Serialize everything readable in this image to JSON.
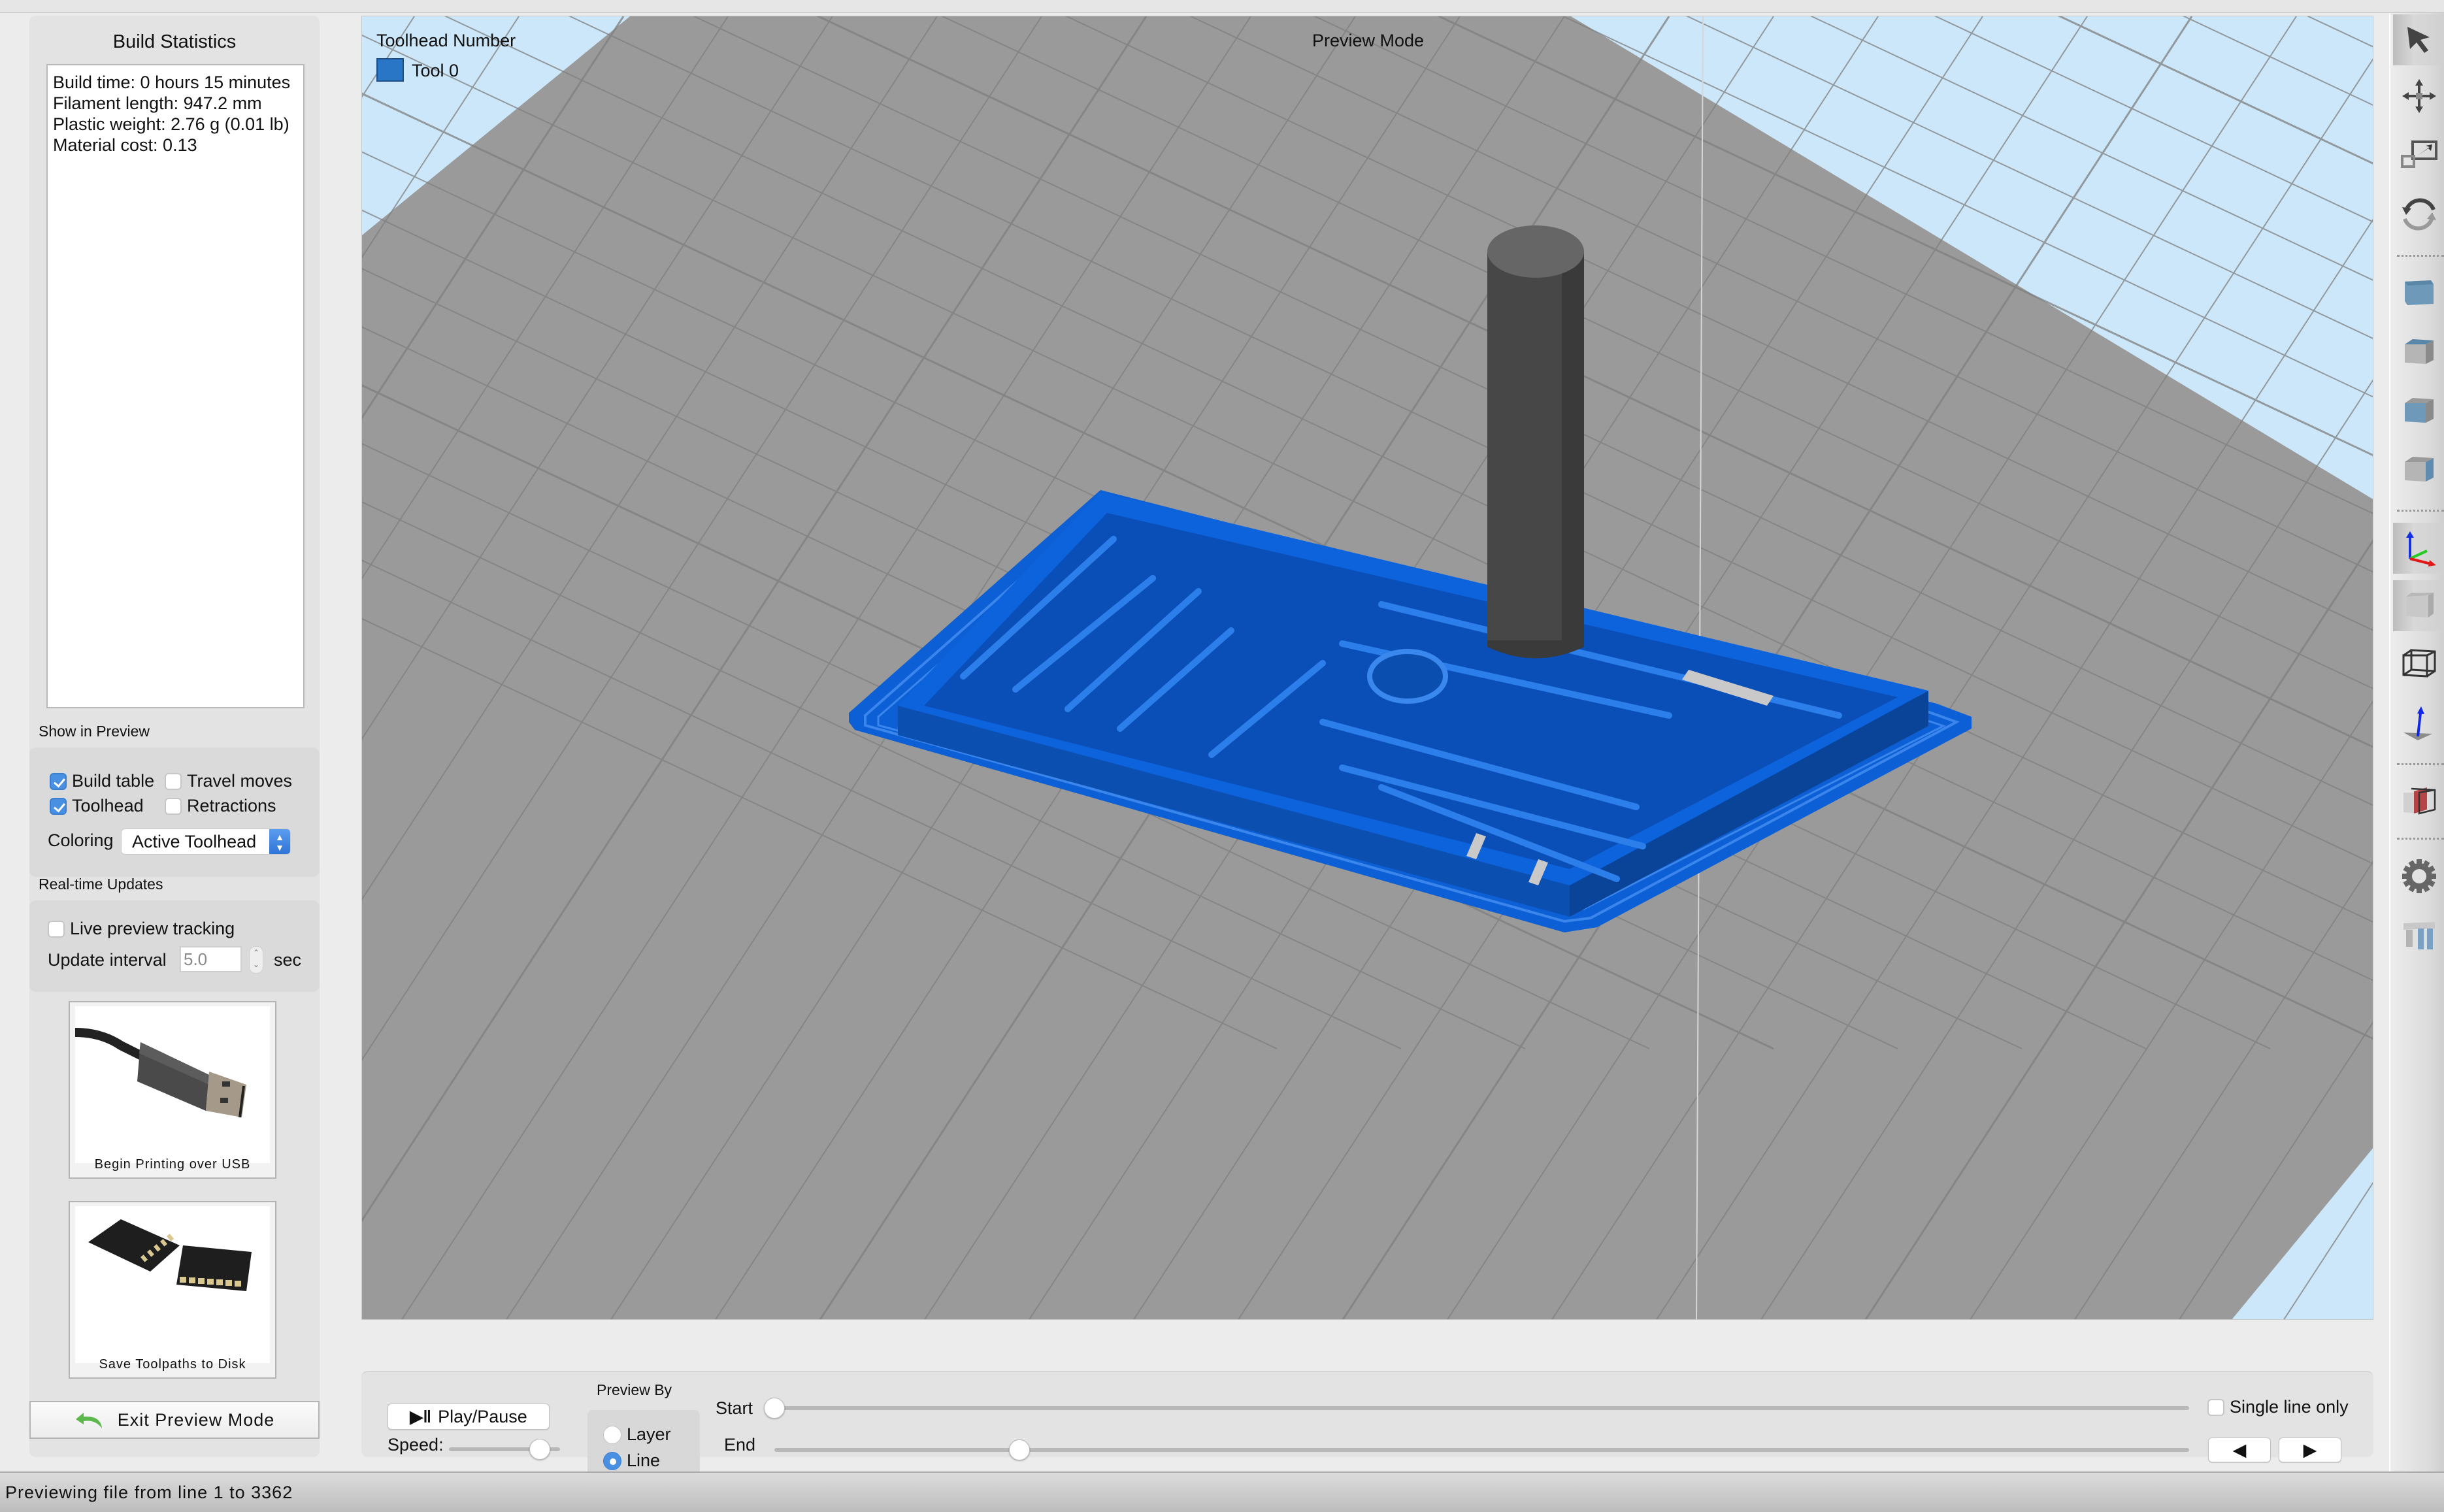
{
  "build_statistics": {
    "title": "Build Statistics",
    "lines": [
      "Build time: 0 hours 15 minutes",
      "Filament length: 947.2 mm",
      "Plastic weight: 2.76 g (0.01 lb)",
      "Material cost: 0.13"
    ]
  },
  "show_in_preview": {
    "label": "Show in Preview",
    "build_table": {
      "label": "Build table",
      "checked": true
    },
    "travel_moves": {
      "label": "Travel moves",
      "checked": false
    },
    "toolhead": {
      "label": "Toolhead",
      "checked": true
    },
    "retractions": {
      "label": "Retractions",
      "checked": false
    },
    "coloring_label": "Coloring",
    "coloring_value": "Active Toolhead"
  },
  "realtime_updates": {
    "label": "Real-time Updates",
    "live_tracking": {
      "label": "Live preview tracking",
      "checked": false
    },
    "interval_label": "Update interval",
    "interval_value": "5.0",
    "interval_unit": "sec"
  },
  "actions": {
    "usb_caption": "Begin Printing over USB",
    "disk_caption": "Save Toolpaths to Disk",
    "exit_label": "Exit Preview Mode"
  },
  "viewport": {
    "legend_title": "Toolhead Number",
    "legend_items": [
      {
        "label": "Tool 0",
        "color": "#2a76c6"
      }
    ],
    "mode_label": "Preview Mode",
    "print_color": "#0a5fd6",
    "sky_color": "#cce7fa",
    "bed_color": "#9a9a9a"
  },
  "toolbar": {
    "tools": [
      "select",
      "move",
      "scale",
      "rotate",
      "view-front",
      "view-top",
      "view-left",
      "view-right",
      "axes",
      "solid-view",
      "wireframe-view",
      "normals",
      "cross-section",
      "settings",
      "supports"
    ]
  },
  "controls": {
    "play_pause_label": "Play/Pause",
    "speed_label": "Speed:",
    "speed_fraction": 0.82,
    "preview_by_label": "Preview By",
    "preview_by_options": [
      {
        "label": "Layer",
        "selected": false
      },
      {
        "label": "Line",
        "selected": true
      }
    ],
    "start_label": "Start",
    "start_fraction": 0.0,
    "end_label": "End",
    "end_fraction": 0.173,
    "single_line_label": "Single line only",
    "single_line_checked": false,
    "prev_glyph": "◀",
    "next_glyph": "▶"
  },
  "status_bar": {
    "text": "Previewing file from line 1 to 3362"
  }
}
